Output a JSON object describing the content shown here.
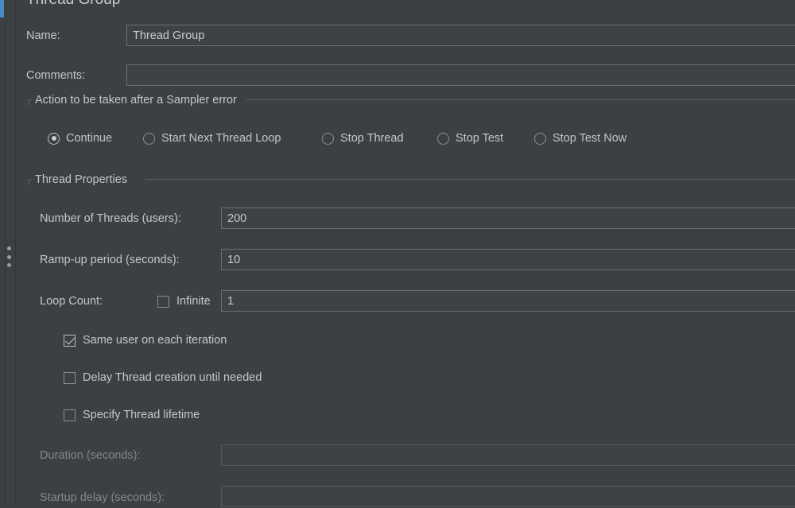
{
  "panel": {
    "title": "Thread Group"
  },
  "name_row": {
    "label": "Name:",
    "value": "Thread Group"
  },
  "comments_row": {
    "label": "Comments:",
    "value": ""
  },
  "sampler_error_group": {
    "legend": "Action to be taken after a Sampler error",
    "options": [
      {
        "label": "Continue",
        "selected": true
      },
      {
        "label": "Start Next Thread Loop",
        "selected": false
      },
      {
        "label": "Stop Thread",
        "selected": false
      },
      {
        "label": "Stop Test",
        "selected": false
      },
      {
        "label": "Stop Test Now",
        "selected": false
      }
    ]
  },
  "thread_properties": {
    "legend": "Thread Properties",
    "num_threads": {
      "label": "Number of Threads (users):",
      "value": "200"
    },
    "ramp_up": {
      "label": "Ramp-up period (seconds):",
      "value": "10"
    },
    "loop_count": {
      "label": "Loop Count:",
      "infinite_label": "Infinite",
      "infinite_checked": false,
      "value": "1"
    },
    "checkboxes": [
      {
        "label": "Same user on each iteration",
        "checked": true
      },
      {
        "label": "Delay Thread creation until needed",
        "checked": false
      },
      {
        "label": "Specify Thread lifetime",
        "checked": false
      }
    ],
    "duration": {
      "label": "Duration (seconds):",
      "value": "",
      "disabled": true
    },
    "startup_delay": {
      "label": "Startup delay (seconds):",
      "value": "",
      "disabled": true
    }
  },
  "colors": {
    "background": "#3c4043",
    "field_border": "#6a6f74",
    "text": "#c3c7cb",
    "text_disabled": "#82878c",
    "accent": "#4a88c7"
  }
}
